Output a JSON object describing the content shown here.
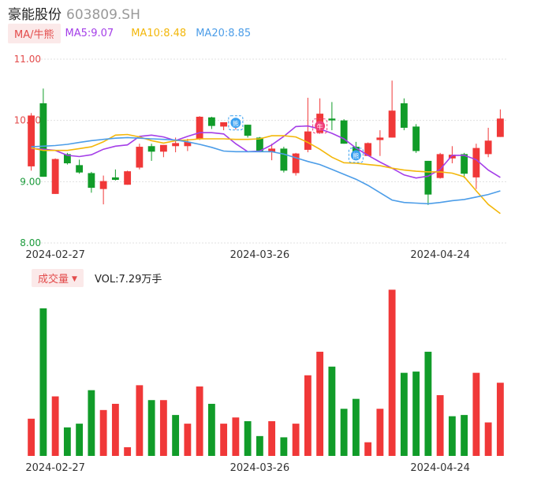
{
  "header": {
    "name": "豪能股份",
    "code": "603809.SH"
  },
  "ma_legend": {
    "selector": "MA/牛熊",
    "ma5": "MA5:9.07",
    "ma10": "MA10:8.48",
    "ma20": "MA20:8.85"
  },
  "volume_legend": {
    "selector": "成交量",
    "caret": "▼",
    "value": "VOL:7.29万手"
  },
  "colors": {
    "up": "#f03838",
    "down": "#119c29",
    "ma5": "#a43ee8",
    "ma10": "#f3b70a",
    "ma20": "#4c9de8",
    "grid": "#e0e0e0",
    "tick_up": "#e34b4b",
    "tick_down": "#1a9a3a"
  },
  "markers": [
    {
      "index": 17,
      "icon": "bear-icon",
      "glyph": "熊",
      "color": "#3aa0f0"
    },
    {
      "index": 24,
      "icon": "bull-icon",
      "glyph": "牛",
      "color": "#f0407a"
    },
    {
      "index": 27,
      "icon": "bear-icon",
      "glyph": "熊",
      "color": "#3aa0f0"
    }
  ],
  "chart_data": [
    {
      "type": "candlestick",
      "title": "",
      "ylim": [
        8.0,
        11.0
      ],
      "yticks": [
        "11.00",
        "10.00",
        "9.00",
        "8.00"
      ],
      "xticks": [
        {
          "index": 2,
          "label": "2024-02-27"
        },
        {
          "index": 19,
          "label": "2024-03-26"
        },
        {
          "index": 34,
          "label": "2024-04-24"
        }
      ],
      "grid": true,
      "candles": [
        {
          "o": 9.25,
          "h": 10.12,
          "l": 9.18,
          "c": 10.08
        },
        {
          "o": 10.28,
          "h": 10.52,
          "l": 9.08,
          "c": 9.08
        },
        {
          "o": 8.8,
          "h": 9.38,
          "l": 8.8,
          "c": 9.37
        },
        {
          "o": 9.45,
          "h": 9.47,
          "l": 9.28,
          "c": 9.3
        },
        {
          "o": 9.27,
          "h": 9.36,
          "l": 9.13,
          "c": 9.15
        },
        {
          "o": 9.14,
          "h": 9.16,
          "l": 8.82,
          "c": 8.9
        },
        {
          "o": 8.88,
          "h": 9.1,
          "l": 8.63,
          "c": 9.01
        },
        {
          "o": 9.07,
          "h": 9.2,
          "l": 9.02,
          "c": 9.03
        },
        {
          "o": 8.95,
          "h": 9.18,
          "l": 8.95,
          "c": 9.17
        },
        {
          "o": 9.23,
          "h": 9.62,
          "l": 9.2,
          "c": 9.57
        },
        {
          "o": 9.58,
          "h": 9.62,
          "l": 9.34,
          "c": 9.49
        },
        {
          "o": 9.49,
          "h": 9.58,
          "l": 9.4,
          "c": 9.6
        },
        {
          "o": 9.58,
          "h": 9.72,
          "l": 9.48,
          "c": 9.63
        },
        {
          "o": 9.58,
          "h": 9.7,
          "l": 9.5,
          "c": 9.65
        },
        {
          "o": 9.7,
          "h": 10.07,
          "l": 9.68,
          "c": 10.06
        },
        {
          "o": 10.05,
          "h": 10.06,
          "l": 9.86,
          "c": 9.91
        },
        {
          "o": 9.9,
          "h": 9.97,
          "l": 9.84,
          "c": 9.97
        },
        {
          "o": 9.96,
          "h": 9.99,
          "l": 9.85,
          "c": 9.96
        },
        {
          "o": 9.93,
          "h": 9.93,
          "l": 9.72,
          "c": 9.75
        },
        {
          "o": 9.72,
          "h": 9.73,
          "l": 9.48,
          "c": 9.5
        },
        {
          "o": 9.48,
          "h": 9.62,
          "l": 9.35,
          "c": 9.54
        },
        {
          "o": 9.54,
          "h": 9.57,
          "l": 9.15,
          "c": 9.18
        },
        {
          "o": 9.14,
          "h": 9.47,
          "l": 9.1,
          "c": 9.46
        },
        {
          "o": 9.52,
          "h": 10.37,
          "l": 9.48,
          "c": 9.82
        },
        {
          "o": 9.8,
          "h": 10.36,
          "l": 9.78,
          "c": 10.11
        },
        {
          "o": 10.03,
          "h": 10.3,
          "l": 9.84,
          "c": 10.0
        },
        {
          "o": 10.0,
          "h": 10.02,
          "l": 9.62,
          "c": 9.62
        },
        {
          "o": 9.57,
          "h": 9.65,
          "l": 9.37,
          "c": 9.43
        },
        {
          "o": 9.42,
          "h": 9.64,
          "l": 9.42,
          "c": 9.63
        },
        {
          "o": 9.68,
          "h": 9.84,
          "l": 9.42,
          "c": 9.72
        },
        {
          "o": 9.72,
          "h": 10.65,
          "l": 9.72,
          "c": 10.16
        },
        {
          "o": 10.28,
          "h": 10.36,
          "l": 9.84,
          "c": 9.88
        },
        {
          "o": 9.9,
          "h": 9.94,
          "l": 9.47,
          "c": 9.5
        },
        {
          "o": 9.34,
          "h": 9.34,
          "l": 8.62,
          "c": 8.79
        },
        {
          "o": 9.06,
          "h": 9.47,
          "l": 9.05,
          "c": 9.45
        },
        {
          "o": 9.38,
          "h": 9.58,
          "l": 9.3,
          "c": 9.44
        },
        {
          "o": 9.45,
          "h": 9.47,
          "l": 9.06,
          "c": 9.13
        },
        {
          "o": 9.07,
          "h": 9.62,
          "l": 8.88,
          "c": 9.55
        },
        {
          "o": 9.45,
          "h": 9.88,
          "l": 9.4,
          "c": 9.67
        },
        {
          "o": 9.73,
          "h": 10.18,
          "l": 9.73,
          "c": 10.03
        }
      ],
      "series": [
        {
          "name": "MA5",
          "values": [
            9.54,
            9.53,
            9.51,
            9.43,
            9.41,
            9.44,
            9.53,
            9.58,
            9.6,
            9.74,
            9.76,
            9.73,
            9.67,
            9.74,
            9.8,
            9.8,
            9.78,
            9.62,
            9.49,
            9.5,
            9.6,
            9.74,
            9.9,
            9.91,
            9.86,
            9.79,
            9.7,
            9.55,
            9.43,
            9.32,
            9.22,
            9.11,
            9.06,
            9.09,
            9.2,
            9.43,
            9.43,
            9.36,
            9.19,
            9.07
          ]
        },
        {
          "name": "MA10",
          "values": [
            9.55,
            9.51,
            9.51,
            9.51,
            9.54,
            9.57,
            9.65,
            9.76,
            9.77,
            9.73,
            9.67,
            9.63,
            9.67,
            9.68,
            9.7,
            9.7,
            9.7,
            9.69,
            9.69,
            9.7,
            9.75,
            9.75,
            9.73,
            9.64,
            9.53,
            9.4,
            9.31,
            9.3,
            9.28,
            9.26,
            9.22,
            9.19,
            9.17,
            9.16,
            9.16,
            9.14,
            9.08,
            8.85,
            8.63,
            8.48
          ]
        },
        {
          "name": "MA20",
          "values": [
            9.57,
            9.58,
            9.59,
            9.61,
            9.64,
            9.67,
            9.69,
            9.71,
            9.72,
            9.71,
            9.7,
            9.69,
            9.68,
            9.65,
            9.61,
            9.56,
            9.5,
            9.49,
            9.49,
            9.49,
            9.49,
            9.45,
            9.39,
            9.33,
            9.28,
            9.2,
            9.12,
            9.04,
            8.94,
            8.82,
            8.7,
            8.66,
            8.65,
            8.64,
            8.66,
            8.69,
            8.71,
            8.75,
            8.79,
            8.85
          ]
        }
      ]
    },
    {
      "type": "bar",
      "ylabel": "",
      "unit": "万手",
      "ylim": [
        0,
        14.5
      ],
      "xticks": [
        {
          "index": 2,
          "label": "2024-02-27"
        },
        {
          "index": 19,
          "label": "2024-03-26"
        },
        {
          "index": 34,
          "label": "2024-04-24"
        }
      ],
      "values": [
        3.0,
        11.9,
        4.8,
        2.3,
        2.6,
        5.3,
        3.7,
        4.2,
        0.7,
        5.7,
        4.5,
        4.5,
        3.3,
        2.6,
        5.6,
        4.2,
        2.6,
        3.1,
        2.8,
        1.6,
        2.8,
        1.5,
        2.6,
        6.5,
        8.4,
        7.2,
        3.8,
        4.6,
        1.1,
        3.8,
        13.4,
        6.7,
        6.8,
        8.4,
        4.9,
        3.2,
        3.3,
        6.7,
        2.7,
        5.9
      ],
      "up": [
        true,
        false,
        true,
        false,
        false,
        false,
        true,
        true,
        true,
        true,
        false,
        true,
        false,
        true,
        true,
        false,
        true,
        true,
        false,
        false,
        true,
        false,
        true,
        true,
        true,
        false,
        false,
        false,
        true,
        true,
        true,
        false,
        false,
        false,
        true,
        false,
        false,
        true,
        true,
        true
      ]
    }
  ]
}
